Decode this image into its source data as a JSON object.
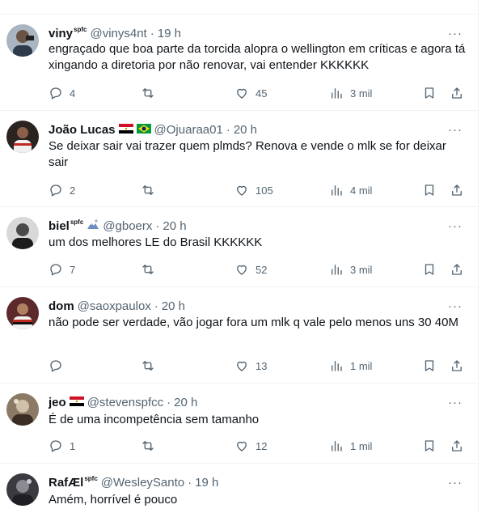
{
  "tweets": [
    {
      "name": "viny",
      "name_sup": "spfc",
      "flag": "",
      "handle": "@vinys4nt",
      "time": "19 h",
      "text": "engraçado que boa parte da torcida alopra o wellington em críticas e agora tá xingando a diretoria por não renovar, vai entender KKKKKK",
      "replies": "4",
      "retweets": "",
      "likes": "45",
      "views": "3 mil",
      "avatar_color": "#7a8a9a"
    },
    {
      "name": "João Lucas",
      "name_sup": "",
      "flag": "egypt-brazil-flags",
      "handle": "@Ojuaraa01",
      "time": "20 h",
      "text": "Se deixar sair vai trazer quem plmds? Renova e vende o mlk se for deixar sair",
      "replies": "2",
      "retweets": "",
      "likes": "105",
      "views": "4 mil",
      "avatar_color": "#3a2c2a"
    },
    {
      "name": "biel",
      "name_sup": "spfc",
      "flag": "mountain-emoji",
      "handle": "@gboerx",
      "time": "20 h",
      "text": "um dos melhores LE do Brasil KKKKKK",
      "replies": "7",
      "retweets": "",
      "likes": "52",
      "views": "3 mil",
      "avatar_color": "#555555"
    },
    {
      "name": "dom",
      "name_sup": "",
      "flag": "",
      "handle": "@saoxpaulox",
      "time": "20 h",
      "text": "não pode ser verdade, vão jogar fora um mlk q vale pelo menos uns 30 40M",
      "replies": "",
      "retweets": "",
      "likes": "13",
      "views": "1 mil",
      "avatar_color": "#8a3030"
    },
    {
      "name": "jeo",
      "name_sup": "",
      "flag": "egypt-flag",
      "handle": "@stevenspfcc",
      "time": "20 h",
      "text": "É de uma incompetência sem tamanho",
      "replies": "1",
      "retweets": "",
      "likes": "12",
      "views": "1 mil",
      "avatar_color": "#6b5a4a"
    },
    {
      "name": "RafÆl",
      "name_sup": "spfc",
      "flag": "",
      "handle": "@WesleySanto",
      "time": "19 h",
      "text": "Amém, horrível é pouco",
      "replies": "",
      "retweets": "",
      "likes": "",
      "views": "",
      "avatar_color": "#4a4a50"
    }
  ],
  "icons": {
    "reply": "reply-icon",
    "retweet": "retweet-icon",
    "like": "heart-icon",
    "views": "views-icon",
    "bookmark": "bookmark-icon",
    "share": "share-icon",
    "more": "more-icon"
  },
  "colors": {
    "text": "#0f1419",
    "secondary": "#536471",
    "border": "#eff3f4"
  }
}
